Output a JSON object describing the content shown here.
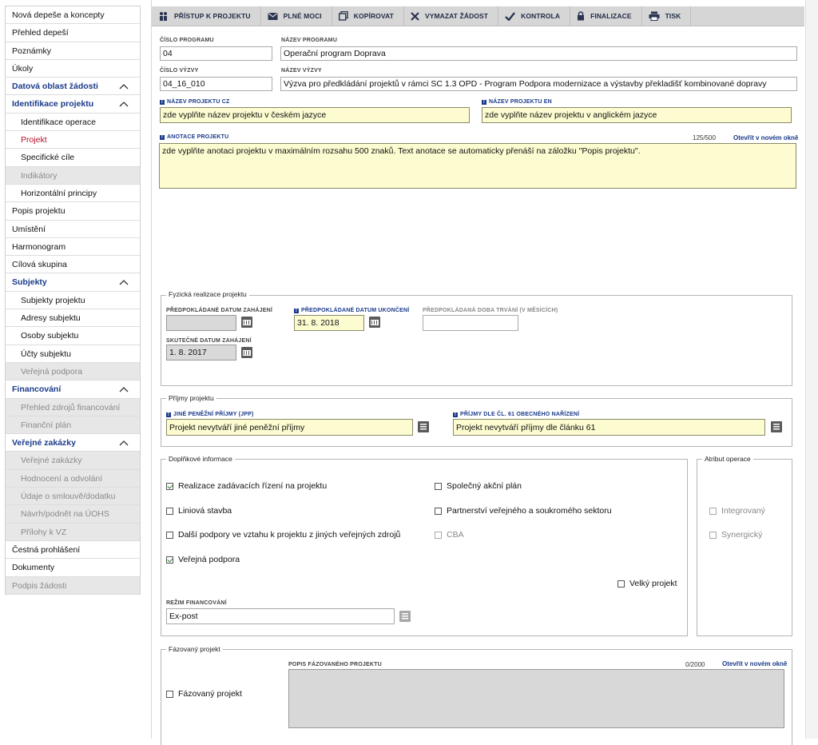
{
  "sidebar": {
    "items": [
      {
        "label": "Nová depeše a koncepty",
        "kind": "normal"
      },
      {
        "label": "Přehled depeší",
        "kind": "normal"
      },
      {
        "label": "Poznámky",
        "kind": "normal"
      },
      {
        "label": "Úkoly",
        "kind": "normal"
      },
      {
        "label": "Datová oblast žádosti",
        "kind": "head"
      },
      {
        "label": "Identifikace projektu",
        "kind": "head"
      },
      {
        "label": "Identifikace operace",
        "kind": "sub"
      },
      {
        "label": "Projekt",
        "kind": "active"
      },
      {
        "label": "Specifické cíle",
        "kind": "sub"
      },
      {
        "label": "Indikátory",
        "kind": "subdis"
      },
      {
        "label": "Horizontální principy",
        "kind": "sub"
      },
      {
        "label": "Popis projektu",
        "kind": "normal"
      },
      {
        "label": "Umístění",
        "kind": "normal"
      },
      {
        "label": "Harmonogram",
        "kind": "normal"
      },
      {
        "label": "Cílová skupina",
        "kind": "normal"
      },
      {
        "label": "Subjekty",
        "kind": "head"
      },
      {
        "label": "Subjekty projektu",
        "kind": "sub"
      },
      {
        "label": "Adresy subjektu",
        "kind": "sub"
      },
      {
        "label": "Osoby subjektu",
        "kind": "sub"
      },
      {
        "label": "Účty subjektu",
        "kind": "sub"
      },
      {
        "label": "Veřejná podpora",
        "kind": "subdis"
      },
      {
        "label": "Financování",
        "kind": "head"
      },
      {
        "label": "Přehled zdrojů financování",
        "kind": "subdis"
      },
      {
        "label": "Finanční plán",
        "kind": "subdis"
      },
      {
        "label": "Veřejné zakázky",
        "kind": "head"
      },
      {
        "label": "Veřejné zakázky",
        "kind": "subdis"
      },
      {
        "label": "Hodnocení a odvolání",
        "kind": "subdis"
      },
      {
        "label": "Údaje o smlouvě/dodatku",
        "kind": "subdis"
      },
      {
        "label": "Návrh/podnět na ÚOHS",
        "kind": "subdis"
      },
      {
        "label": "Přílohy k VZ",
        "kind": "subdis"
      },
      {
        "label": "Čestná prohlášení",
        "kind": "normal"
      },
      {
        "label": "Dokumenty",
        "kind": "normal"
      },
      {
        "label": "Podpis žádosti",
        "kind": "disabled"
      }
    ]
  },
  "toolbar": {
    "access": "PŘÍSTUP K PROJEKTU",
    "power": "PLNÉ MOCI",
    "copy": "KOPÍROVAT",
    "delete": "VYMAZAT ŽÁDOST",
    "check": "KONTROLA",
    "finalize": "FINALIZACE",
    "print": "TISK"
  },
  "form": {
    "program_number_label": "ČÍSLO PROGRAMU",
    "program_number": "04",
    "program_name_label": "NÁZEV PROGRAMU",
    "program_name": "Operační program Doprava",
    "call_number_label": "ČÍSLO VÝZVY",
    "call_number": "04_16_010",
    "call_name_label": "NÁZEV VÝZVY",
    "call_name": "Výzva pro předkládání projektů v rámci SC 1.3 OPD - Program Podpora modernizace a výstavby překladišť kombinované dopravy",
    "project_name_cz_label": "NÁZEV PROJEKTU CZ",
    "project_name_cz": "zde vyplňte název projektu v českém jazyce",
    "project_name_en_label": "NÁZEV PROJEKTU EN",
    "project_name_en": "zde vyplňte název projektu v anglickém jazyce",
    "annotation_label": "ANOTACE PROJEKTU",
    "annotation_count": "125/500",
    "open_new_window": "Otevřít v novém okně",
    "annotation": "zde vyplňte anotaci projektu v maximálním rozsahu 500 znaků. Text anotace se automaticky přenáší na záložku \"Popis projektu\"."
  },
  "physical": {
    "legend": "Fyzická realizace projektu",
    "start_planned_label": "PŘEDPOKLÁDANÉ DATUM ZAHÁJENÍ",
    "start_planned": "",
    "end_planned_label": "PŘEDPOKLÁDANÉ DATUM UKONČENÍ",
    "end_planned": "31. 8. 2018",
    "duration_label": "PŘEDPOKLÁDANÁ DOBA TRVÁNÍ (V MĚSÍCÍCH)",
    "duration": "",
    "start_actual_label": "SKUTEČNÉ DATUM ZAHÁJENÍ",
    "start_actual": "1. 8. 2017"
  },
  "income": {
    "legend": "Příjmy projektu",
    "jpp_label": "JINÉ PENĚŽNÍ PŘÍJMY (JPP)",
    "jpp": "Projekt nevytváří jiné peněžní příjmy",
    "art61_label": "PŘÍJMY DLE ČL. 61 OBECNÉHO NAŘÍZENÍ",
    "art61": "Projekt nevytváří příjmy dle článku 61"
  },
  "additional": {
    "legend": "Doplňkové informace",
    "procurement": "Realizace zadávacích řízení na projektu",
    "linear": "Liniová stavba",
    "other_support": "Další podpory ve vztahu k projektu z jiných veřejných zdrojů",
    "public_support": "Veřejná podpora",
    "joint_plan": "Společný akční plán",
    "ppp": "Partnerství veřejného a soukromého sektoru",
    "cba": "CBA",
    "big_project": "Velký projekt",
    "financing_mode_label": "REŽIM FINANCOVÁNÍ",
    "financing_mode": "Ex-post"
  },
  "attribute": {
    "legend": "Atribut operace",
    "integrated": "Integrovaný",
    "synergic": "Synergický"
  },
  "phased": {
    "legend": "Fázovaný projekt",
    "checkbox": "Fázovaný projekt",
    "desc_label": "POPIS FÁZOVANÉHO PROJEKTU",
    "count": "0/2000",
    "open_new_window": "Otevřít v novém okně"
  }
}
